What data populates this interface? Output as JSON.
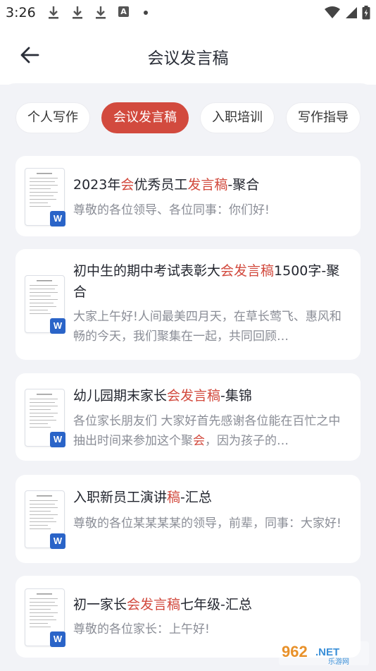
{
  "status_bar": {
    "time": "3:26",
    "indicator_letter": "A",
    "icons": [
      "download-icon",
      "download-icon",
      "download-icon",
      "a-badge-icon",
      "dot-icon",
      "wifi-icon",
      "signal-icon",
      "battery-icon"
    ]
  },
  "header": {
    "title": "会议发言稿",
    "back_icon": "arrow-left-icon"
  },
  "tabs": [
    {
      "label": "个人写作",
      "active": false
    },
    {
      "label": "会议发言稿",
      "active": true
    },
    {
      "label": "入职培训",
      "active": false
    },
    {
      "label": "写作指导",
      "active": false
    }
  ],
  "colors": {
    "accent": "#d24a3e",
    "title": "#23262f",
    "desc": "#8a8d96",
    "background": "#f2f3f7",
    "word_badge": "#2a64c8"
  },
  "articles": [
    {
      "title_segments": [
        {
          "t": "2023年",
          "hl": false
        },
        {
          "t": "会",
          "hl": true
        },
        {
          "t": "优秀员工",
          "hl": false
        },
        {
          "t": "发言稿",
          "hl": true
        },
        {
          "t": "-聚合",
          "hl": false
        }
      ],
      "desc_segments": [
        {
          "t": "尊敬的各位领导、各位同事：你们好!",
          "hl": false
        }
      ],
      "thumb_badge": "W"
    },
    {
      "title_segments": [
        {
          "t": "初中生的期中考试表彰大",
          "hl": false
        },
        {
          "t": "会发言稿",
          "hl": true
        },
        {
          "t": "1500字-聚合",
          "hl": false
        }
      ],
      "desc_segments": [
        {
          "t": "大家上午好!人间最美四月天，在草长莺飞、惠风和畅的今天，我们聚集在一起，共同回顾…",
          "hl": false
        }
      ],
      "thumb_badge": "W"
    },
    {
      "title_segments": [
        {
          "t": "幼儿园期末家长",
          "hl": false
        },
        {
          "t": "会发言稿",
          "hl": true
        },
        {
          "t": "-集锦",
          "hl": false
        }
      ],
      "desc_segments": [
        {
          "t": "各位家长朋友们 大家好首先感谢各位能在百忙之中抽出时间来参加这个聚",
          "hl": false
        },
        {
          "t": "会",
          "hl": true
        },
        {
          "t": "，因为孩子的…",
          "hl": false
        }
      ],
      "thumb_badge": "W"
    },
    {
      "title_segments": [
        {
          "t": "入职新员工演讲",
          "hl": false
        },
        {
          "t": "稿",
          "hl": true
        },
        {
          "t": "-汇总",
          "hl": false
        }
      ],
      "desc_segments": [
        {
          "t": "尊敬的各位某某某某的领导，前辈，同事：大家好!",
          "hl": false
        }
      ],
      "thumb_badge": "W"
    },
    {
      "title_segments": [
        {
          "t": "初一家长",
          "hl": false
        },
        {
          "t": "会发言稿",
          "hl": true
        },
        {
          "t": "七年级-汇总",
          "hl": false
        }
      ],
      "desc_segments": [
        {
          "t": "尊敬的各位家长：上午好!",
          "hl": false
        }
      ],
      "thumb_badge": "W"
    }
  ],
  "watermark": {
    "main": "962",
    "suffix": ".NET",
    "sub": "乐游网"
  }
}
